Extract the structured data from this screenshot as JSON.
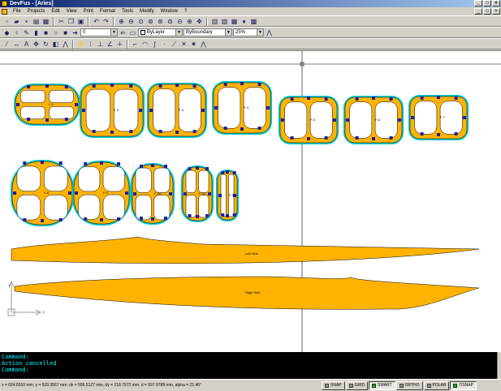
{
  "window": {
    "title": "DevFus - [Aries]",
    "min": "_",
    "max": "□",
    "close": "×"
  },
  "menu": [
    "File",
    "Projects",
    "Edit",
    "View",
    "Print",
    "Format",
    "Tools",
    "Modify",
    "Window",
    "?"
  ],
  "toolbar": {
    "layer_value": "0",
    "color_value": "ByLayer",
    "linetype_value": "ByBoundary",
    "zoom_value": "25%"
  },
  "drawing": {
    "formers": [
      {
        "label": "F-1",
        "shape": "oval"
      },
      {
        "label": "F-2",
        "shape": "rect"
      },
      {
        "label": "F-3",
        "shape": "rect"
      },
      {
        "label": "F-4",
        "shape": "rect"
      },
      {
        "label": "F-5",
        "shape": "rect"
      },
      {
        "label": "F-6",
        "shape": "rect"
      },
      {
        "label": "F-7",
        "shape": "rect"
      },
      {
        "label": "F-8",
        "shape": "oval"
      },
      {
        "label": "F-9",
        "shape": "oval"
      },
      {
        "label": "F-10",
        "shape": "oval"
      },
      {
        "label": "F-11",
        "shape": "oval"
      },
      {
        "label": "F-12",
        "shape": "oval"
      }
    ],
    "sides": [
      {
        "label": "Left Side"
      },
      {
        "label": "Right Side"
      }
    ],
    "colors": {
      "fill": "#ffb300",
      "outline": "#00c8d0",
      "block": "#2020a0",
      "ink": "#000000"
    }
  },
  "console": {
    "lines": [
      "Command:",
      "Action cancelled",
      "Command:"
    ]
  },
  "status": {
    "coords": "x = 624.6910 mm, y = 529.3567 mm; dx = 556.5127 mm, dy = 218.7972 mm, d = 597.9788 mm, alpha = 21.46°",
    "buttons": [
      {
        "label": "SNAP",
        "on": false
      },
      {
        "label": "GRID",
        "on": false
      },
      {
        "label": "SMART",
        "on": true
      },
      {
        "label": "ORTHO",
        "on": false
      },
      {
        "label": "POLAR",
        "on": false
      },
      {
        "label": "OSNAP",
        "on": true
      }
    ]
  }
}
